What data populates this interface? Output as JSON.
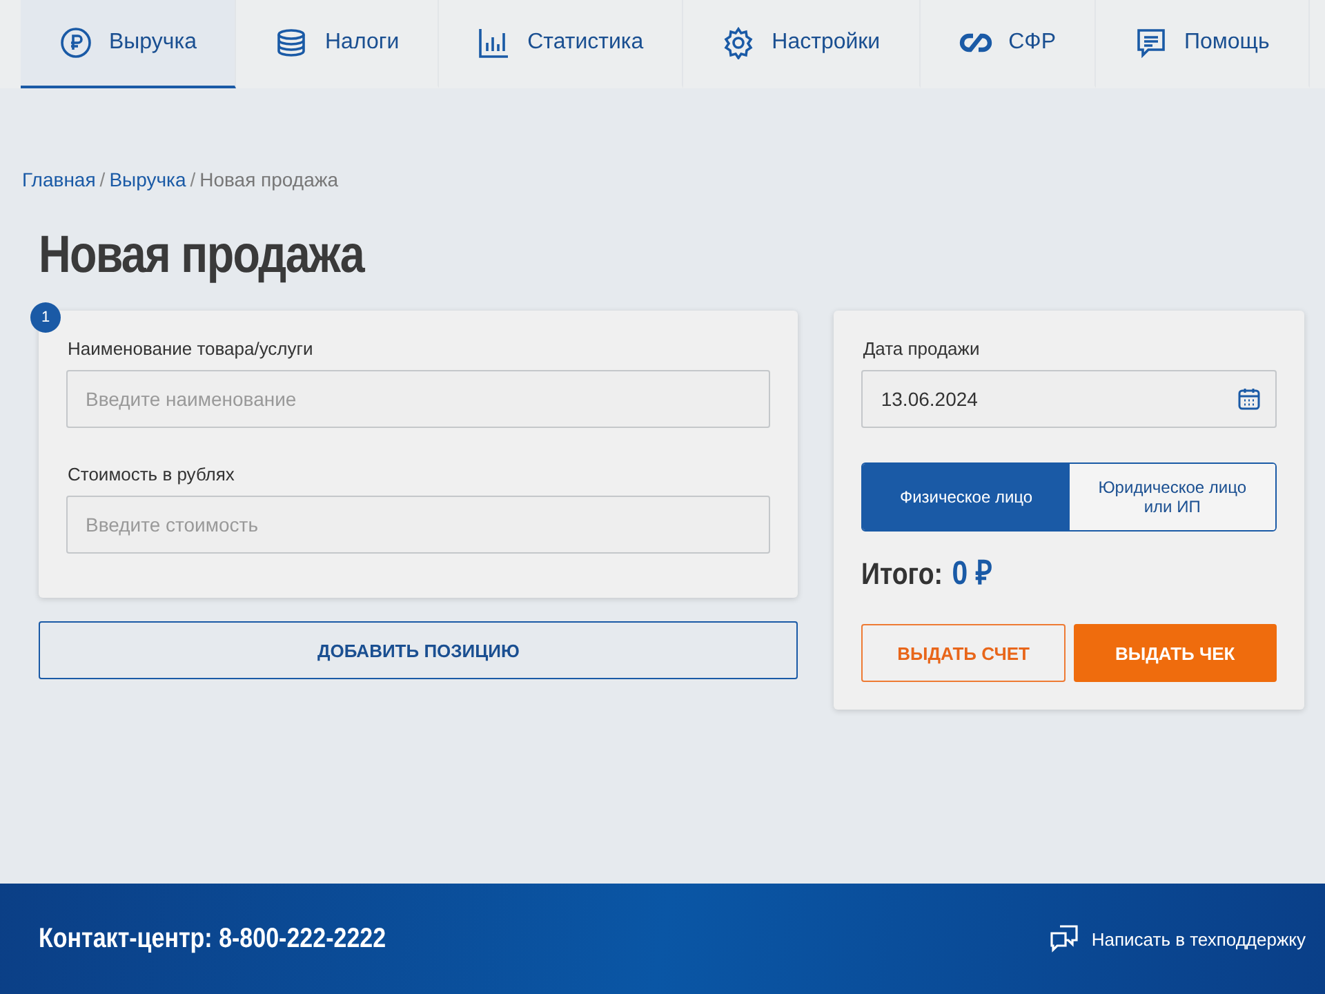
{
  "tabs": [
    {
      "label": "Выручка",
      "kind": "ruble",
      "selected": true
    },
    {
      "label": "Налоги",
      "kind": "coins",
      "selected": false
    },
    {
      "label": "Статистика",
      "kind": "chart",
      "selected": false
    },
    {
      "label": "Настройки",
      "kind": "gear",
      "selected": false
    },
    {
      "label": "СФР",
      "kind": "sfr",
      "selected": false
    },
    {
      "label": "Помощь",
      "kind": "message",
      "selected": false
    }
  ],
  "breadcrumb": [
    {
      "label": "Главная",
      "link": true
    },
    {
      "label": "Выручка",
      "link": true
    },
    {
      "label": "Новая продажа",
      "link": false
    }
  ],
  "breadcrumb_separator": "/",
  "title": "Новая продажа",
  "position": {
    "step": "1",
    "fields": [
      {
        "label": "Наименование товара/услуги",
        "placeholder": "Введите наименование"
      },
      {
        "label": "Стоимость в рублях",
        "placeholder": "Введите стоимость"
      }
    ]
  },
  "add_button": "ДОБАВИТЬ ПОЗИЦИЮ",
  "sale": {
    "date_label": "Дата продажи",
    "date_value": "13.06.2024",
    "buyer_types": [
      {
        "label": "Физическое лицо",
        "selected": true
      },
      {
        "label": "Юридическое лицо или ИП",
        "selected": false
      }
    ],
    "total_label": "Итого:",
    "total_value": "0 ₽",
    "buttons": [
      {
        "label": "ВЫДАТЬ СЧЕТ",
        "kind": "outline"
      },
      {
        "label": "ВЫДАТЬ ЧЕК",
        "kind": "filled"
      }
    ]
  },
  "footer": {
    "contact": "Контакт-центр: 8-800-222-2222",
    "support_link": "Написать в техподдержку"
  }
}
